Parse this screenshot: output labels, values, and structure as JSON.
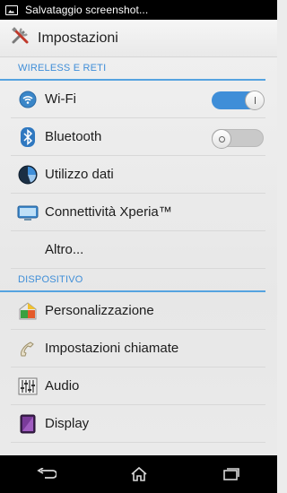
{
  "status_bar": {
    "text": "Salvataggio screenshot..."
  },
  "action_bar": {
    "title": "Impostazioni",
    "icon": "tools-icon"
  },
  "sections": [
    {
      "header": "WIRELESS E RETI",
      "items": [
        {
          "label": "Wi-Fi",
          "icon": "wifi-icon",
          "toggle": "on"
        },
        {
          "label": "Bluetooth",
          "icon": "bluetooth-icon",
          "toggle": "off"
        },
        {
          "label": "Utilizzo dati",
          "icon": "data-usage-icon"
        },
        {
          "label": "Connettività Xperia™",
          "icon": "xperia-connectivity-icon"
        },
        {
          "label": "Altro...",
          "icon": ""
        }
      ]
    },
    {
      "header": "DISPOSITIVO",
      "items": [
        {
          "label": "Personalizzazione",
          "icon": "personalization-icon"
        },
        {
          "label": "Impostazioni chiamate",
          "icon": "phone-icon"
        },
        {
          "label": "Audio",
          "icon": "audio-equalizer-icon"
        },
        {
          "label": "Display",
          "icon": "display-icon"
        }
      ]
    }
  ],
  "nav_bar": {
    "buttons": [
      "back-icon",
      "home-icon",
      "recent-apps-icon"
    ]
  },
  "colors": {
    "accent": "#3f8ed8",
    "status_bar": "#000000",
    "background": "#ececec"
  }
}
